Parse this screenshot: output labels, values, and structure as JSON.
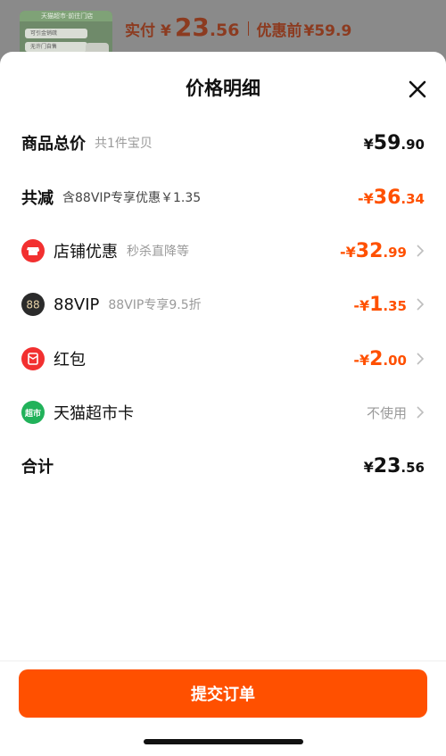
{
  "header": {
    "promo_strip": "天猫超市·前往门店",
    "promo_tag_1": "可引金销疏",
    "promo_tag_2": "无许门自售",
    "pay_label": "实付",
    "currency": "¥",
    "pay_int": "23",
    "pay_dec": ".56",
    "before_label": "优惠前",
    "before_value": "59.9"
  },
  "sheet": {
    "title": "价格明细",
    "close_icon": "close-icon",
    "rows": [
      {
        "label": "商品总价",
        "sub": "共1件宝贝",
        "prefix": "¥",
        "int": "59",
        "dec": ".90",
        "color": "#111111"
      },
      {
        "label": "共减",
        "sub": "含88VIP专享优惠￥1.35",
        "prefix": "-¥",
        "int": "36",
        "dec": ".34",
        "color": "#ff5000"
      },
      {
        "label": "店铺优惠",
        "sub": "秒杀直降等",
        "prefix": "-¥",
        "int": "32",
        "dec": ".99",
        "icon": "store-icon"
      },
      {
        "label": "88VIP",
        "sub": "88VIP专享9.5折",
        "prefix": "-¥",
        "int": "1",
        "dec": ".35",
        "icon": "vip88-icon",
        "icon_text": "88"
      },
      {
        "label": "红包",
        "sub": "",
        "prefix": "-¥",
        "int": "2",
        "dec": ".00",
        "icon": "red-packet-icon"
      },
      {
        "label": "天猫超市卡",
        "sub": "",
        "value_text": "不使用",
        "icon": "tmall-supermarket-card-icon",
        "icon_text": "超市"
      },
      {
        "label": "合计",
        "sub": "",
        "prefix": "¥",
        "int": "23",
        "dec": ".56"
      }
    ]
  },
  "footer": {
    "submit_label": "提交订单"
  },
  "colors": {
    "accent": "#ff5000",
    "store_icon": "#f23030",
    "vip_icon": "#2b2b2b",
    "tmall_card_icon": "#21b25a"
  }
}
